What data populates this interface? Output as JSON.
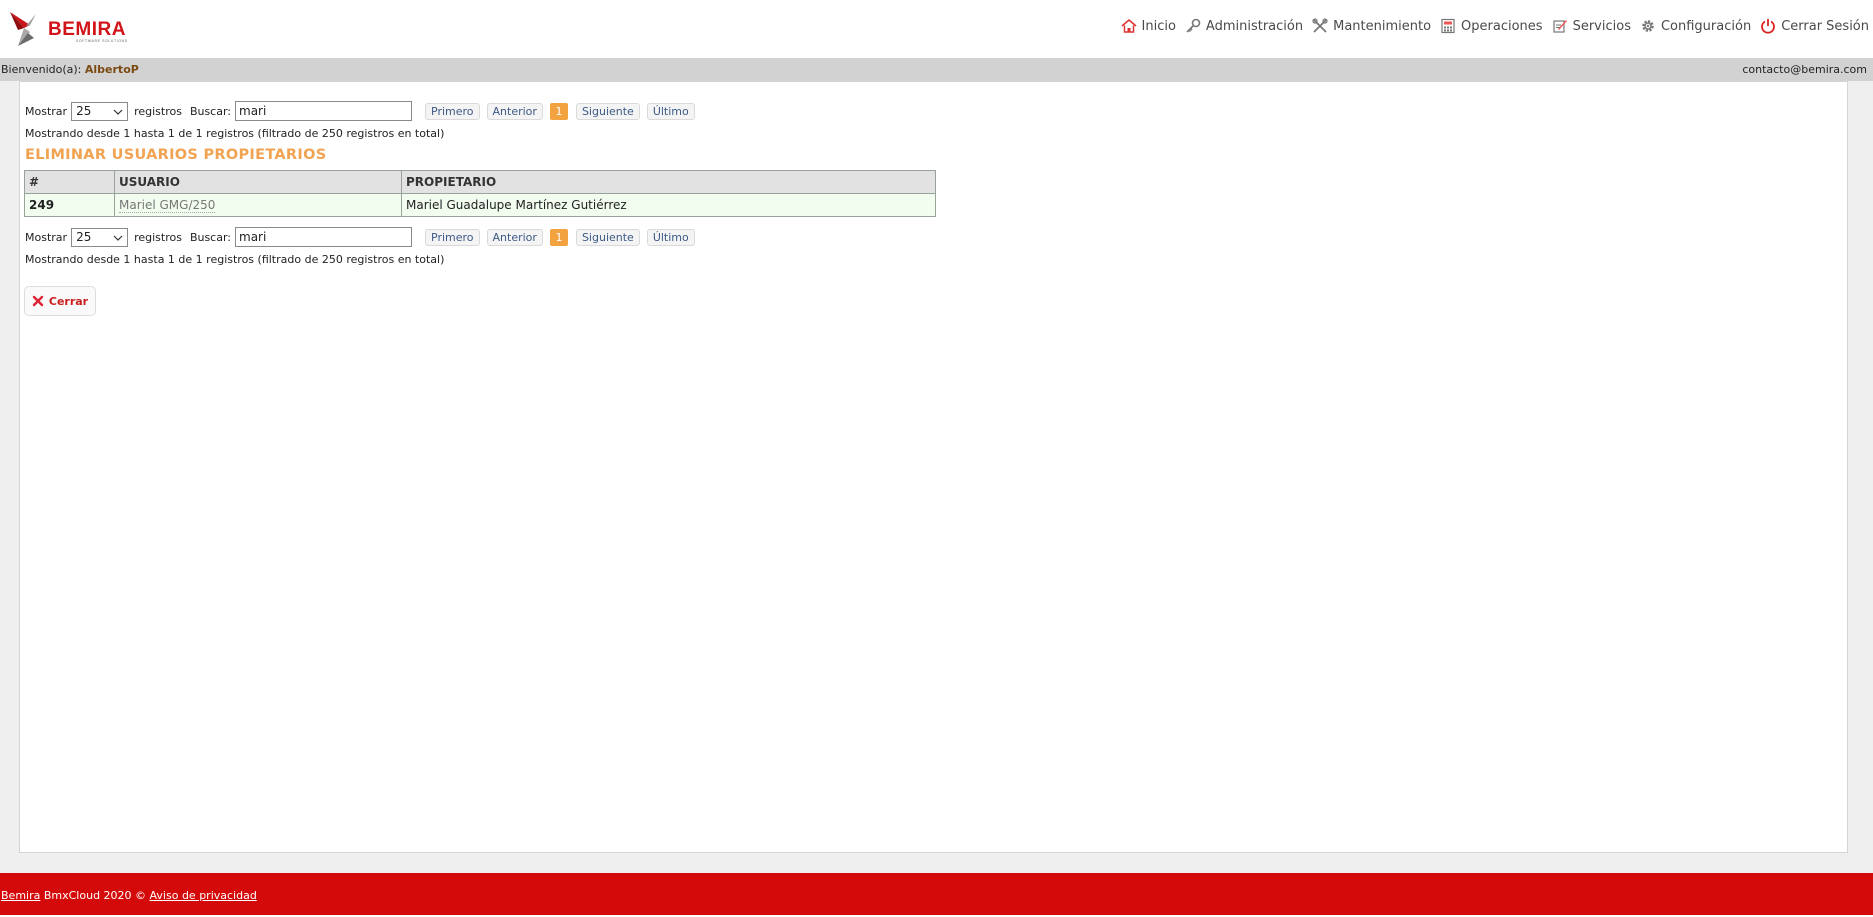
{
  "brand": {
    "name": "BEMIRA",
    "tagline": "SOFTWARE SOLUTIONS",
    "accent_color": "#d0141a"
  },
  "nav": [
    {
      "label": "Inicio",
      "icon": "home-icon"
    },
    {
      "label": "Administración",
      "icon": "key-icon"
    },
    {
      "label": "Mantenimiento",
      "icon": "tools-icon"
    },
    {
      "label": "Operaciones",
      "icon": "calculator-icon"
    },
    {
      "label": "Servicios",
      "icon": "edit-icon"
    },
    {
      "label": "Configuración",
      "icon": "gear-icon"
    },
    {
      "label": "Cerrar Sesión",
      "icon": "power-icon"
    }
  ],
  "welcome": {
    "prefix": "Bienvenido(a):",
    "user": "AlbertoP",
    "contact": "contacto@bemira.com"
  },
  "toolbar": {
    "show_label": "Mostrar",
    "page_size": "25",
    "records_label": "registros",
    "search_label": "Buscar:",
    "search_value": "mari",
    "first": "Primero",
    "prev": "Anterior",
    "current_page": "1",
    "next": "Siguiente",
    "last": "Último"
  },
  "info_text": "Mostrando desde 1 hasta 1 de 1 registros (filtrado de 250 registros en total)",
  "title": "ELIMINAR USUARIOS PROPIETARIOS",
  "table": {
    "headers": [
      "#",
      "USUARIO",
      "PROPIETARIO"
    ],
    "rows": [
      {
        "num": "249",
        "usuario": "Mariel GMG/250",
        "propietario": "Mariel Guadalupe Martínez Gutiérrez"
      }
    ]
  },
  "close_button": "Cerrar",
  "footer": {
    "company": "Bemira",
    "text": " BmxCloud 2020 © ",
    "privacy": "Aviso de privacidad",
    "bg_color": "#d40a0a"
  }
}
